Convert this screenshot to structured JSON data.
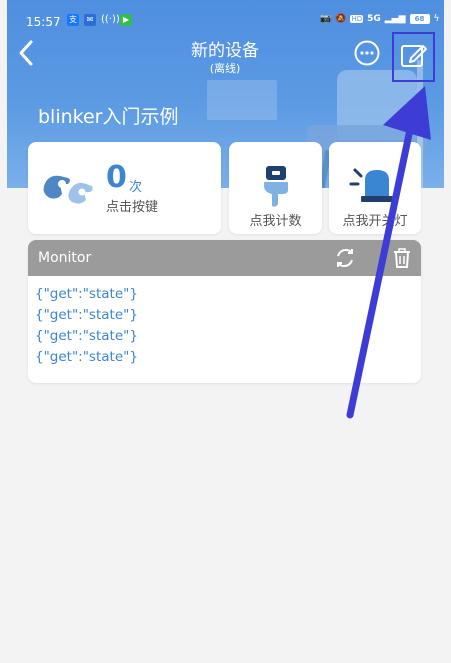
{
  "status_bar": {
    "time": "15:57",
    "left_icons": [
      "alipay-icon",
      "chat-icon",
      "hotspot-icon",
      "play-icon"
    ],
    "network": "5G",
    "battery": "68"
  },
  "header": {
    "title": "新的设备",
    "subtitle": "(离线)",
    "device_name": "blinker入门示例"
  },
  "widgets": {
    "counter": {
      "count": "0",
      "unit": "次",
      "label": "点击按键"
    },
    "count_button": {
      "label": "点我计数"
    },
    "light_button": {
      "label": "点我开关灯"
    }
  },
  "monitor": {
    "title": "Monitor",
    "lines": [
      "{\"get\":\"state\"}",
      "{\"get\":\"state\"}",
      "{\"get\":\"state\"}",
      "{\"get\":\"state\"}"
    ]
  },
  "colors": {
    "accent": "#3b86d3",
    "header": "#5c9ae3",
    "annotation": "#3d3dd6"
  }
}
